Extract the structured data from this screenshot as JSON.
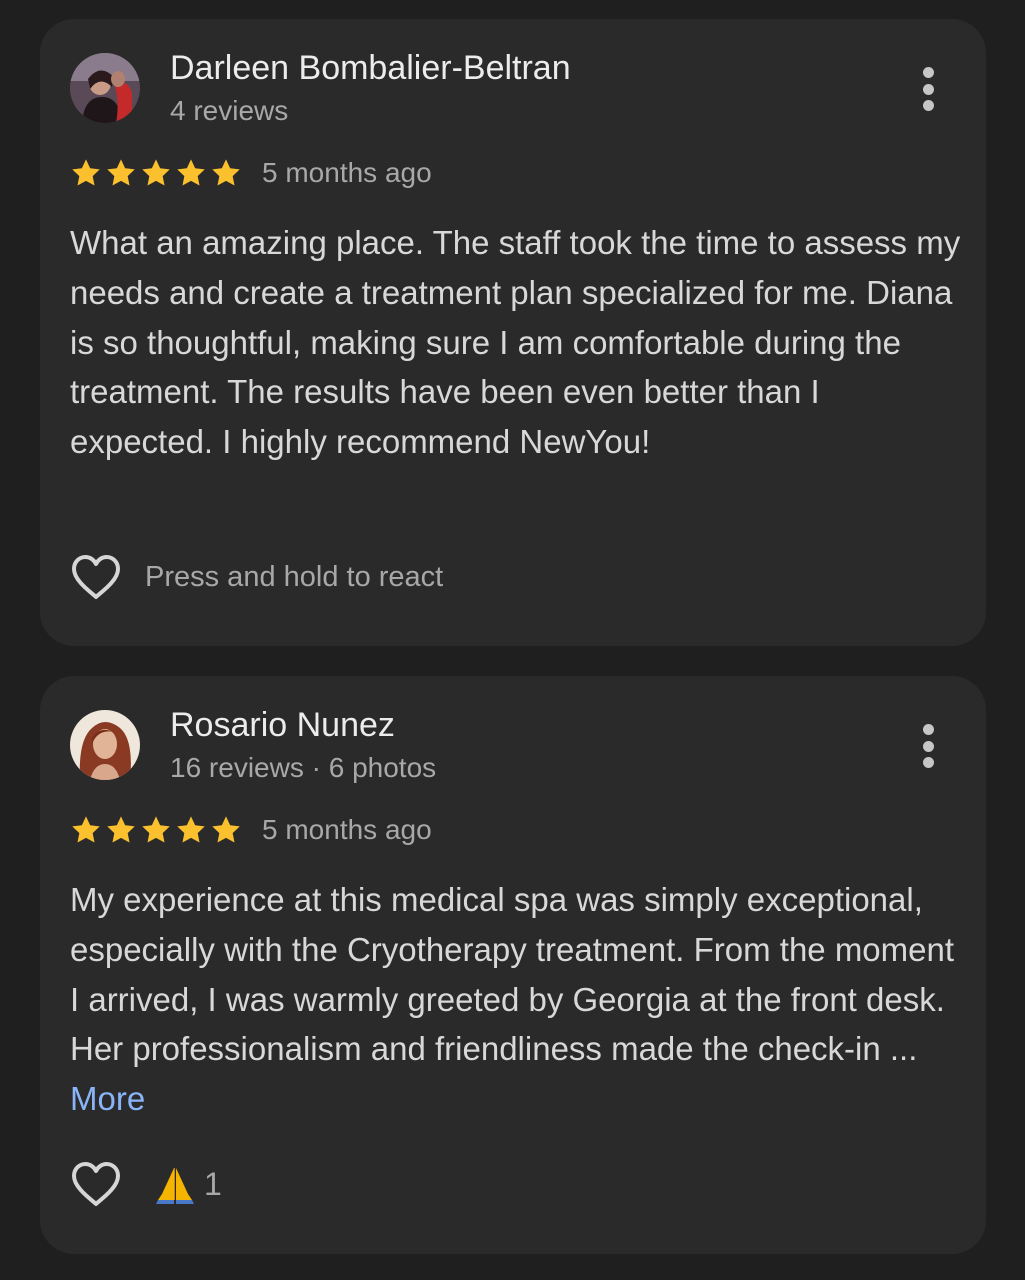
{
  "reviews": [
    {
      "name": "Darleen Bombalier-Beltran",
      "meta": "4 reviews",
      "rating": 5,
      "time": "5 months ago",
      "text": "What an amazing place. The staff took the time to assess my needs and create a treatment plan specialized for me. Diana is so thoughtful, making sure I am comfortable during the treatment. The results have been even better than I expected. I highly recommend NewYou!",
      "react_hint": "Press and hold to react",
      "icons": {
        "avatar": "avatar-photo",
        "menu": "more-vert-icon",
        "react": "heart-outline-icon"
      }
    },
    {
      "name": "Rosario Nunez",
      "meta": "16 reviews · 6 photos",
      "rating": 5,
      "time": "5 months ago",
      "text": "My experience at this medical spa was simply exceptional, especially with the Cryotherapy treatment. From the moment I arrived, I was warmly greeted by Georgia at the front desk. Her professionalism and friendliness made the check-in ...",
      "more_label": "More",
      "reaction": {
        "emoji": "🙏",
        "count": "1"
      },
      "icons": {
        "avatar": "avatar-photo",
        "menu": "more-vert-icon",
        "react": "heart-outline-icon",
        "reaction": "folded-hands-icon"
      }
    }
  ],
  "colors": {
    "background": "#1f1f1f",
    "card": "#2a2a2a",
    "star": "#fbc02d",
    "link": "#8ab4f8",
    "secondary_text": "#a8a8a8"
  }
}
